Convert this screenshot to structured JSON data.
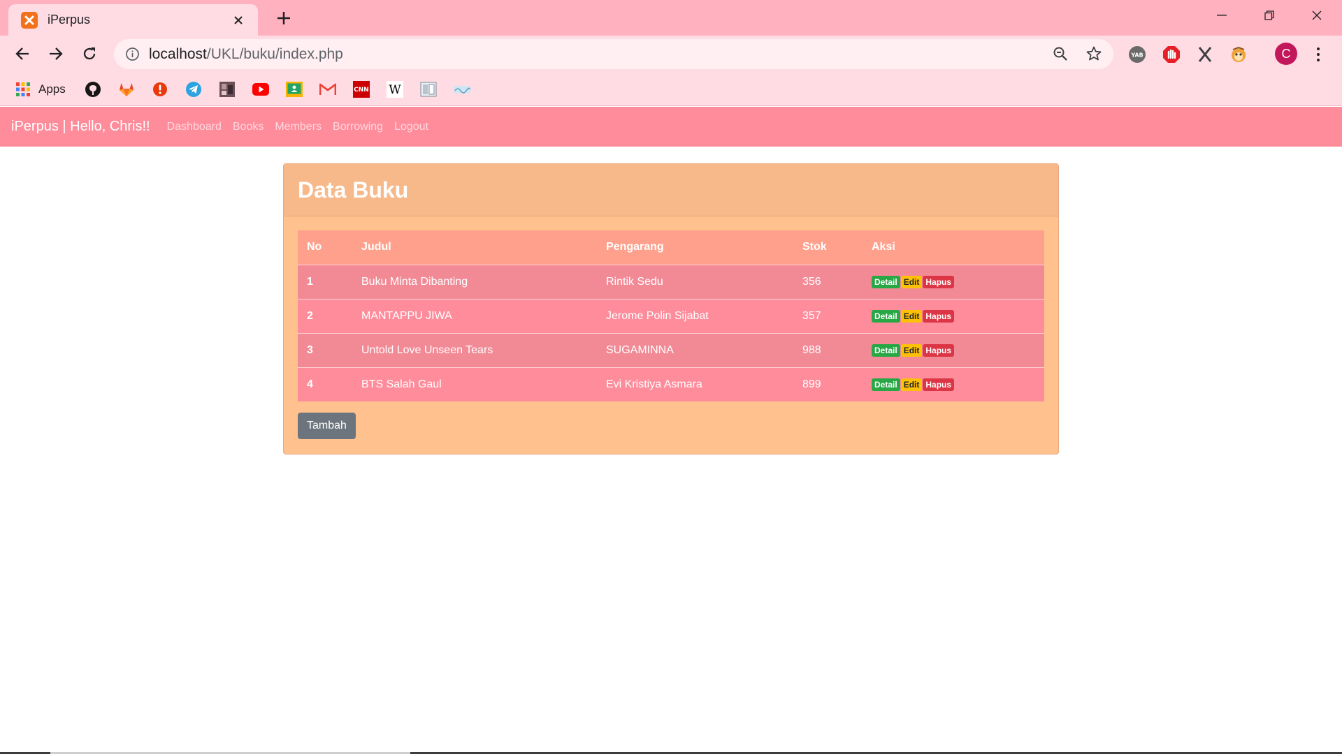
{
  "browser": {
    "tab_title": "iPerpus",
    "favicon_glyph": "ꟾ",
    "url_host": "localhost",
    "url_path": "/UKL/buku/index.php",
    "profile_initial": "C",
    "bookmarks": [
      {
        "label": "Apps",
        "icon": "apps-grid-icon"
      },
      {
        "label": "",
        "icon": "github-icon"
      },
      {
        "label": "",
        "icon": "gitlab-icon"
      },
      {
        "label": "",
        "icon": "alert-icon"
      },
      {
        "label": "",
        "icon": "telegram-icon"
      },
      {
        "label": "",
        "icon": "photo-icon"
      },
      {
        "label": "",
        "icon": "youtube-icon"
      },
      {
        "label": "",
        "icon": "classroom-icon"
      },
      {
        "label": "",
        "icon": "gmail-icon"
      },
      {
        "label": "",
        "icon": "cnn-icon"
      },
      {
        "label": "",
        "icon": "wikipedia-icon"
      },
      {
        "label": "",
        "icon": "book-icon"
      },
      {
        "label": "",
        "icon": "bookmark-text-icon"
      }
    ],
    "extensions": [
      "yab-icon",
      "adblock-icon",
      "x-icon",
      "monkey-icon"
    ],
    "colors": {
      "tabbar": "#ffb1c0",
      "toolbar": "#ffdce3"
    }
  },
  "navbar": {
    "brand": "iPerpus | Hello, Chris!!",
    "links": [
      "Dashboard",
      "Books",
      "Members",
      "Borrowing",
      "Logout"
    ],
    "color": "#ff8c9b"
  },
  "card": {
    "title": "Data Buku",
    "columns": [
      "No",
      "Judul",
      "Pengarang",
      "Stok",
      "Aksi"
    ],
    "rows": [
      {
        "no": "1",
        "judul": "Buku Minta Dibanting",
        "pengarang": "Rintik Sedu",
        "stok": "356"
      },
      {
        "no": "2",
        "judul": "MANTAPPU JIWA",
        "pengarang": "Jerome Polin Sijabat",
        "stok": "357"
      },
      {
        "no": "3",
        "judul": "Untold Love Unseen Tears",
        "pengarang": "SUGAMINNA",
        "stok": "988"
      },
      {
        "no": "4",
        "judul": "BTS Salah Gaul",
        "pengarang": "Evi Kristiya Asmara",
        "stok": "899"
      }
    ],
    "actions": {
      "detail": "Detail",
      "edit": "Edit",
      "hapus": "Hapus"
    },
    "add_button": "Tambah",
    "colors": {
      "card": "#ffc28e",
      "header": "#f7b98a",
      "table_head": "#ffa08c",
      "detail": "#28a745",
      "edit": "#ffc107",
      "hapus": "#dc3545",
      "button": "#6c757d"
    }
  }
}
